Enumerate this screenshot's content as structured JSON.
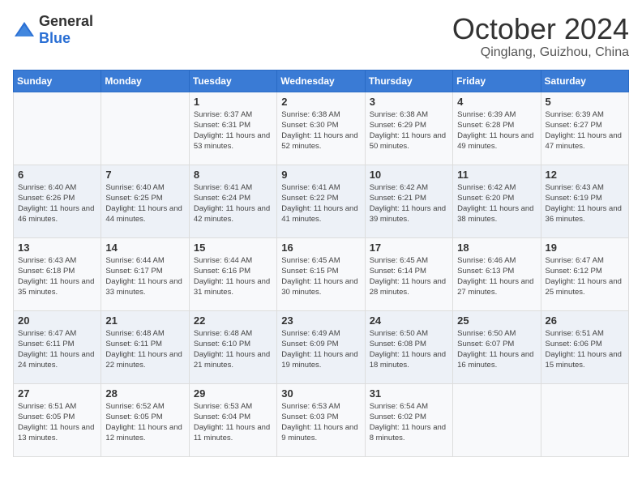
{
  "header": {
    "logo_general": "General",
    "logo_blue": "Blue",
    "month": "October 2024",
    "location": "Qinglang, Guizhou, China"
  },
  "weekdays": [
    "Sunday",
    "Monday",
    "Tuesday",
    "Wednesday",
    "Thursday",
    "Friday",
    "Saturday"
  ],
  "weeks": [
    [
      {
        "day": "",
        "detail": ""
      },
      {
        "day": "",
        "detail": ""
      },
      {
        "day": "1",
        "detail": "Sunrise: 6:37 AM\nSunset: 6:31 PM\nDaylight: 11 hours and 53 minutes."
      },
      {
        "day": "2",
        "detail": "Sunrise: 6:38 AM\nSunset: 6:30 PM\nDaylight: 11 hours and 52 minutes."
      },
      {
        "day": "3",
        "detail": "Sunrise: 6:38 AM\nSunset: 6:29 PM\nDaylight: 11 hours and 50 minutes."
      },
      {
        "day": "4",
        "detail": "Sunrise: 6:39 AM\nSunset: 6:28 PM\nDaylight: 11 hours and 49 minutes."
      },
      {
        "day": "5",
        "detail": "Sunrise: 6:39 AM\nSunset: 6:27 PM\nDaylight: 11 hours and 47 minutes."
      }
    ],
    [
      {
        "day": "6",
        "detail": "Sunrise: 6:40 AM\nSunset: 6:26 PM\nDaylight: 11 hours and 46 minutes."
      },
      {
        "day": "7",
        "detail": "Sunrise: 6:40 AM\nSunset: 6:25 PM\nDaylight: 11 hours and 44 minutes."
      },
      {
        "day": "8",
        "detail": "Sunrise: 6:41 AM\nSunset: 6:24 PM\nDaylight: 11 hours and 42 minutes."
      },
      {
        "day": "9",
        "detail": "Sunrise: 6:41 AM\nSunset: 6:22 PM\nDaylight: 11 hours and 41 minutes."
      },
      {
        "day": "10",
        "detail": "Sunrise: 6:42 AM\nSunset: 6:21 PM\nDaylight: 11 hours and 39 minutes."
      },
      {
        "day": "11",
        "detail": "Sunrise: 6:42 AM\nSunset: 6:20 PM\nDaylight: 11 hours and 38 minutes."
      },
      {
        "day": "12",
        "detail": "Sunrise: 6:43 AM\nSunset: 6:19 PM\nDaylight: 11 hours and 36 minutes."
      }
    ],
    [
      {
        "day": "13",
        "detail": "Sunrise: 6:43 AM\nSunset: 6:18 PM\nDaylight: 11 hours and 35 minutes."
      },
      {
        "day": "14",
        "detail": "Sunrise: 6:44 AM\nSunset: 6:17 PM\nDaylight: 11 hours and 33 minutes."
      },
      {
        "day": "15",
        "detail": "Sunrise: 6:44 AM\nSunset: 6:16 PM\nDaylight: 11 hours and 31 minutes."
      },
      {
        "day": "16",
        "detail": "Sunrise: 6:45 AM\nSunset: 6:15 PM\nDaylight: 11 hours and 30 minutes."
      },
      {
        "day": "17",
        "detail": "Sunrise: 6:45 AM\nSunset: 6:14 PM\nDaylight: 11 hours and 28 minutes."
      },
      {
        "day": "18",
        "detail": "Sunrise: 6:46 AM\nSunset: 6:13 PM\nDaylight: 11 hours and 27 minutes."
      },
      {
        "day": "19",
        "detail": "Sunrise: 6:47 AM\nSunset: 6:12 PM\nDaylight: 11 hours and 25 minutes."
      }
    ],
    [
      {
        "day": "20",
        "detail": "Sunrise: 6:47 AM\nSunset: 6:11 PM\nDaylight: 11 hours and 24 minutes."
      },
      {
        "day": "21",
        "detail": "Sunrise: 6:48 AM\nSunset: 6:11 PM\nDaylight: 11 hours and 22 minutes."
      },
      {
        "day": "22",
        "detail": "Sunrise: 6:48 AM\nSunset: 6:10 PM\nDaylight: 11 hours and 21 minutes."
      },
      {
        "day": "23",
        "detail": "Sunrise: 6:49 AM\nSunset: 6:09 PM\nDaylight: 11 hours and 19 minutes."
      },
      {
        "day": "24",
        "detail": "Sunrise: 6:50 AM\nSunset: 6:08 PM\nDaylight: 11 hours and 18 minutes."
      },
      {
        "day": "25",
        "detail": "Sunrise: 6:50 AM\nSunset: 6:07 PM\nDaylight: 11 hours and 16 minutes."
      },
      {
        "day": "26",
        "detail": "Sunrise: 6:51 AM\nSunset: 6:06 PM\nDaylight: 11 hours and 15 minutes."
      }
    ],
    [
      {
        "day": "27",
        "detail": "Sunrise: 6:51 AM\nSunset: 6:05 PM\nDaylight: 11 hours and 13 minutes."
      },
      {
        "day": "28",
        "detail": "Sunrise: 6:52 AM\nSunset: 6:05 PM\nDaylight: 11 hours and 12 minutes."
      },
      {
        "day": "29",
        "detail": "Sunrise: 6:53 AM\nSunset: 6:04 PM\nDaylight: 11 hours and 11 minutes."
      },
      {
        "day": "30",
        "detail": "Sunrise: 6:53 AM\nSunset: 6:03 PM\nDaylight: 11 hours and 9 minutes."
      },
      {
        "day": "31",
        "detail": "Sunrise: 6:54 AM\nSunset: 6:02 PM\nDaylight: 11 hours and 8 minutes."
      },
      {
        "day": "",
        "detail": ""
      },
      {
        "day": "",
        "detail": ""
      }
    ]
  ]
}
